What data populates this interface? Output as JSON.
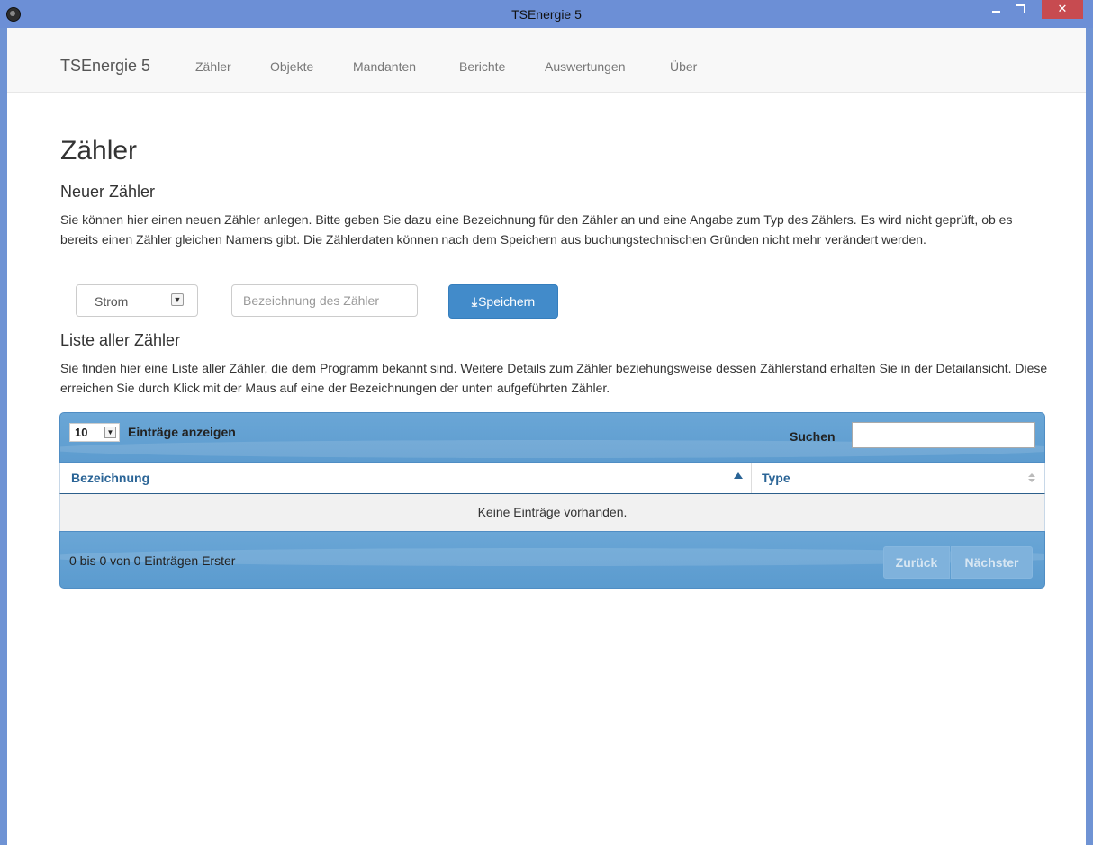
{
  "window": {
    "title": "TSEnergie 5",
    "minimize_label": "–",
    "close_label": "✕"
  },
  "navbar": {
    "brand": "TSEnergie 5",
    "items": [
      {
        "label": "Zähler"
      },
      {
        "label": "Objekte"
      },
      {
        "label": "Mandanten"
      },
      {
        "label": "Berichte"
      },
      {
        "label": "Auswertungen"
      },
      {
        "label": "Über"
      }
    ]
  },
  "page": {
    "title": "Zähler",
    "new_heading": "Neuer Zähler",
    "new_text": "Sie können hier einen neuen Zähler anlegen. Bitte geben Sie dazu eine Bezeichnung für den Zähler an und eine Angabe zum Typ des Zählers. Es wird nicht geprüft, ob es bereits einen Zähler gleichen Namens gibt. Die Zählerdaten können nach dem Speichern aus buchungstechnischen Gründen nicht mehr verändert werden.",
    "type_select_value": "Strom",
    "name_placeholder": "Bezeichnung des Zähler",
    "save_label": "Speichern",
    "list_heading": "Liste aller Zähler",
    "list_text": "Sie finden hier eine Liste aller Zähler, die dem Programm bekannt sind. Weitere Details zum Zähler beziehungsweise dessen Zählerstand erhalten Sie in der Detailansicht. Diese erreichen Sie durch Klick mit der Maus auf eine der Bezeichnungen der unten aufgeführten Zähler."
  },
  "table": {
    "length_value": "10",
    "length_label": "Einträge anzeigen",
    "search_label": "Suchen",
    "search_value": "",
    "columns": [
      "Bezeichnung",
      "Type"
    ],
    "empty_message": "Keine Einträge vorhanden.",
    "info": "0 bis 0 von 0 Einträgen Erster",
    "prev_label": "Zurück",
    "next_label": "Nächster"
  },
  "colors": {
    "titlebar": "#6c8fd6",
    "primary_button": "#428bca",
    "table_header": "#5d9ccf",
    "close_button": "#c74b50"
  }
}
